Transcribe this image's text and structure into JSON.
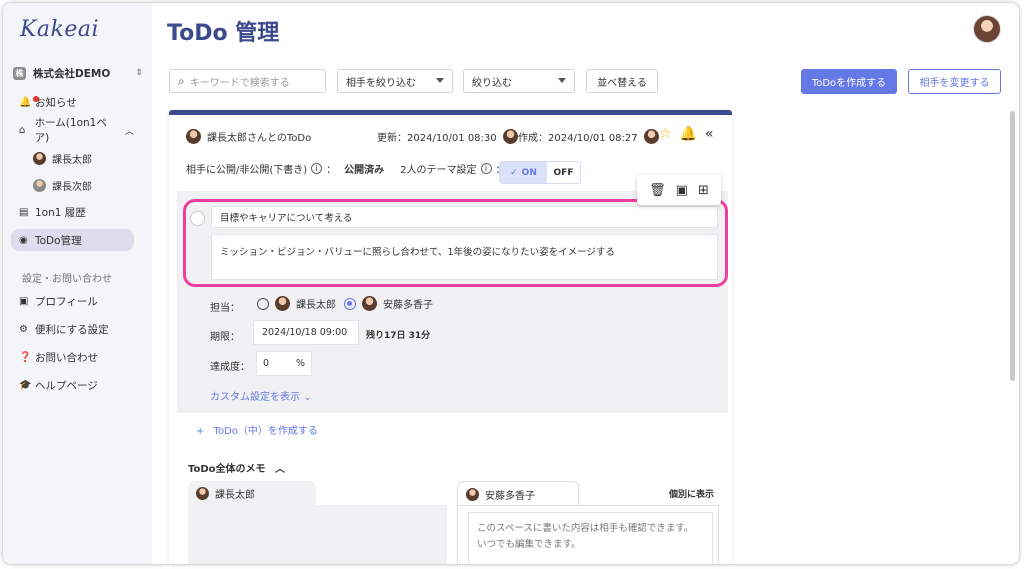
{
  "app": {
    "logo": "Kakeai",
    "page_title": "ToDo 管理"
  },
  "sidebar": {
    "company": "株式会社DEMO",
    "company_badge": "株",
    "items": [
      {
        "label": "お知らせ",
        "icon": "bell-icon"
      },
      {
        "label": "ホーム(1on1ペア)",
        "icon": "home-icon"
      },
      {
        "label": "課長太郎",
        "icon": "avatar"
      },
      {
        "label": "課長次郎",
        "icon": "avatar"
      },
      {
        "label": "1on1 履歴",
        "icon": "history-icon"
      },
      {
        "label": "ToDo管理",
        "icon": "check-circle-icon"
      }
    ],
    "section_label": "設定・お問い合わせ",
    "settings": [
      {
        "label": "プロフィール",
        "icon": "badge-icon"
      },
      {
        "label": "便利にする設定",
        "icon": "gear-icon"
      },
      {
        "label": "お問い合わせ",
        "icon": "question-icon"
      },
      {
        "label": "ヘルプページ",
        "icon": "graduation-cap-icon"
      }
    ]
  },
  "toolbar": {
    "search_placeholder": "キーワードで検索する",
    "filter_partner": "相手を絞り込む",
    "filter": "絞り込む",
    "sort": "並べ替える",
    "create": "ToDoを作成する",
    "change_partner": "相手を変更する"
  },
  "card": {
    "title": "課長太郎さんとのToDo",
    "updated": "更新：2024/10/01 08:30",
    "created": "作成：2024/10/01 08:27",
    "publish_label": "相手に公開/非公開(下書き)",
    "publish_status": "公開済み",
    "theme_label": "2人のテーマ設定",
    "toggle_on": "ON",
    "toggle_off": "OFF",
    "todo_title": "目標やキャリアについて考える",
    "todo_desc": "ミッション・ビジョン・バリューに照らし合わせて、1年後の姿になりたい姿をイメージする",
    "assignee_label": "担当：",
    "assignee_a": "課長太郎",
    "assignee_b": "安藤多香子",
    "due_label": "期限：",
    "due_value": "2024/10/18 09:00",
    "remaining": "残り17日 31分",
    "progress_label": "達成度：",
    "progress_value": "0",
    "progress_unit": "%",
    "custom_link": "カスタム設定を表示",
    "create_sub": "ToDo（中）を作成する",
    "memo_title": "ToDo全体のメモ",
    "memo_left_name": "課長太郎",
    "memo_right_name": "安藤多香子",
    "memo_individual": "個別に表示",
    "memo_placeholder_1": "このスペースに書いた内容は相手も確認できます。",
    "memo_placeholder_2": "いつでも編集できます。"
  },
  "colors": {
    "brand": "#3c4a8e",
    "accent": "#6478e6",
    "highlight": "#ee3fa0"
  }
}
